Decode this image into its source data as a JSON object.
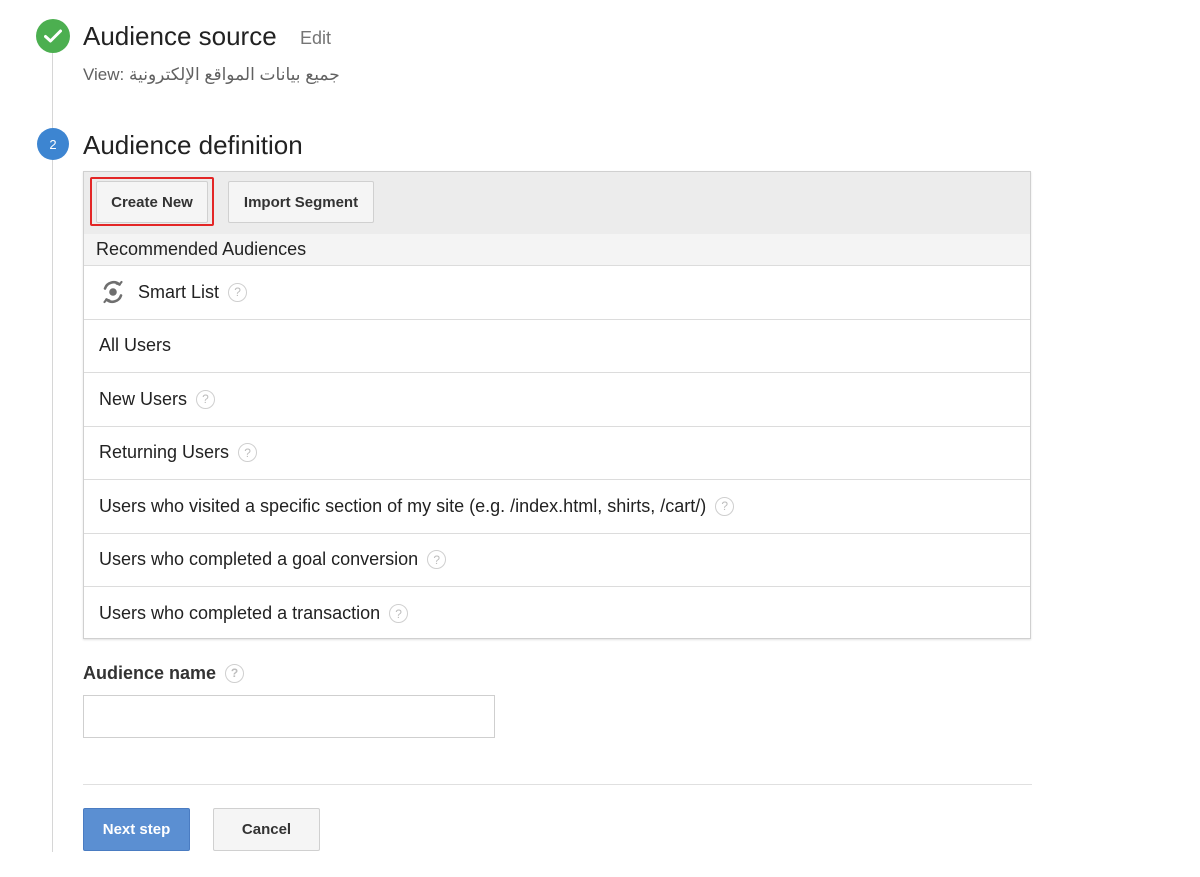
{
  "step1": {
    "title": "Audience source",
    "edit_label": "Edit",
    "view_text": "View: جميع بيانات المواقع الإلكترونية"
  },
  "step2": {
    "number": "2",
    "title": "Audience definition"
  },
  "toolbar": {
    "create_new_label": "Create New",
    "import_segment_label": "Import Segment"
  },
  "recommended": {
    "header": "Recommended Audiences",
    "items": [
      {
        "label": "Smart List",
        "help": "?"
      },
      {
        "label": "All Users"
      },
      {
        "label": "New Users",
        "help": "?"
      },
      {
        "label": "Returning Users",
        "help": "?"
      },
      {
        "label": "Users who visited a specific section of my site (e.g. /index.html, shirts, /cart/)",
        "help": "?"
      },
      {
        "label": "Users who completed a goal conversion",
        "help": "?"
      },
      {
        "label": "Users who completed a transaction",
        "help": "?"
      }
    ]
  },
  "audience_name": {
    "label": "Audience name",
    "help": "?",
    "value": "",
    "placeholder": ""
  },
  "actions": {
    "next_label": "Next step",
    "cancel_label": "Cancel"
  },
  "colors": {
    "step_done": "#4caf50",
    "step_active": "#3d85d1",
    "primary_button": "#5b8fd2",
    "highlight": "#e32626"
  },
  "icons": {
    "step_done": "check-icon",
    "smart_list": "smart-list-icon",
    "help": "help-icon"
  }
}
